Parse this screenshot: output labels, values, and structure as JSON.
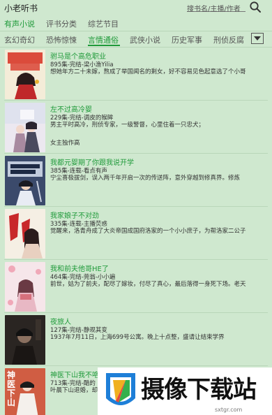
{
  "header": {
    "app_title": "小老听书",
    "search_placeholder": "搜书名/主播/作者"
  },
  "primary_tabs": [
    {
      "label": "有声小说",
      "active": true
    },
    {
      "label": "评书分类",
      "active": false
    },
    {
      "label": "综艺节目",
      "active": false
    }
  ],
  "secondary_tabs": [
    {
      "label": "玄幻奇幻",
      "active": false
    },
    {
      "label": "恐怖惊悚",
      "active": false
    },
    {
      "label": "言情通俗",
      "active": true
    },
    {
      "label": "武侠小说",
      "active": false
    },
    {
      "label": "历史军事",
      "active": false
    },
    {
      "label": "刑侦反腐",
      "active": false
    }
  ],
  "accent_color": "#1f9a3a",
  "books": [
    {
      "title": "驸马是个高危职业",
      "meta": "895集-完结-梁小渔Yilia",
      "desc": "想她年方二十未嫁，熬成了举国闻名的剩女，好不容易见色起意选了个小哥",
      "cover_color": "#f4ecd8",
      "cover_icon": "cover-girl-red-dress"
    },
    {
      "title": "左不过高冷婴",
      "meta": "229集-完结-调皮的猴眸",
      "desc": "男主平时高冷，刑侦专家，一级警督，心里住着一只忠犬；\n\n女主独作高",
      "cover_color": "#e8e4ee",
      "cover_icon": "cover-couple-sky"
    },
    {
      "title": "我都元婴期了你跟我说开学",
      "meta": "385集-连载-看点有声",
      "desc": "宁尘喜极拔剑，误入两千年开启一次的传送阵，意外穿越到修真界。修炼",
      "cover_color": "#3b4a6b",
      "cover_icon": "cover-boy-sword"
    },
    {
      "title": "我家娘子不对劲",
      "meta": "335集-连载-主播荧惑",
      "desc": "觉醒来，洛青舟成了大炎帝国成国府洛家的一个小小庶子，为帮洛家二公子",
      "cover_color": "#f5efe4",
      "cover_icon": "cover-girl-red-ribbon"
    },
    {
      "title": "我和前夫他哥HE了",
      "meta": "464集-完结-莞翁-小小遍",
      "desc": "前世，姑为了前夫，配尽了嫁妆，付尽了真心，最后落得一身死下场。老天",
      "cover_color": "#f6e6ea",
      "cover_icon": "cover-girl-pink-flowers"
    },
    {
      "title": "夜旅人",
      "meta": "127集-完结-静观其变",
      "desc": "1937年7月11日，上海699号公寓。晚上十点整，盛请让结束学界",
      "cover_color": "#2a2522",
      "cover_icon": "cover-dark-portrait"
    },
    {
      "title": "神医下山我不咯",
      "meta": "713集-完结-酷的",
      "desc": "叶晨下山退婚，却",
      "cover_color": "#c8503c",
      "cover_icon": "cover-man-white-robe",
      "cover_text": "神医下山"
    }
  ],
  "watermark": {
    "text": "摄像下载站",
    "url": "sxtgr.com"
  }
}
